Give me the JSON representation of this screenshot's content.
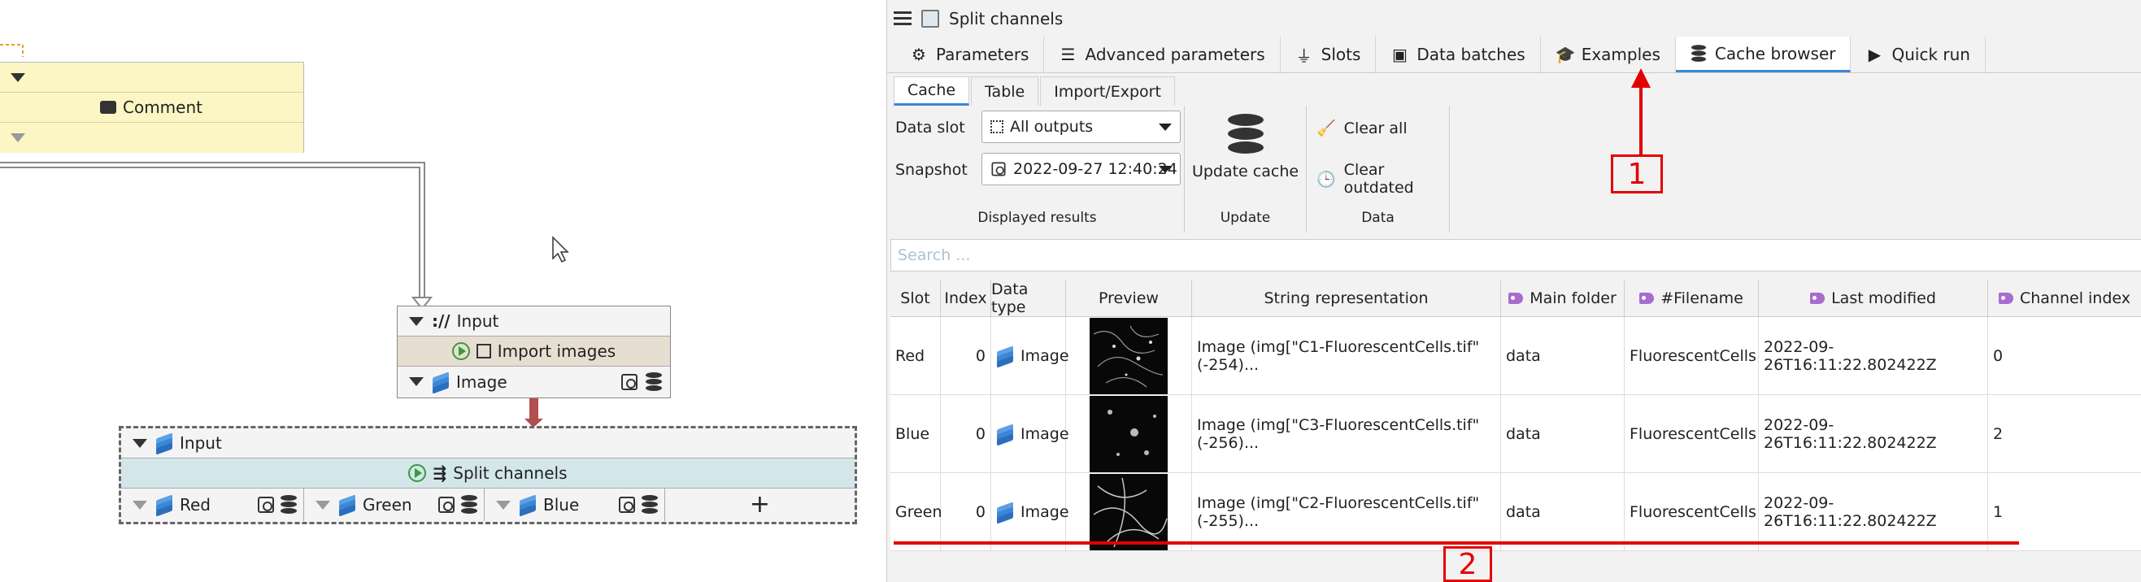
{
  "canvas": {
    "comment_node": {
      "label": "Comment"
    },
    "import_node": {
      "input_label": "Input",
      "input_prefix": "://",
      "action": "Import images",
      "output": "Image"
    },
    "split_node": {
      "input_label": "Input",
      "action": "Split channels",
      "outputs": [
        "Red",
        "Green",
        "Blue"
      ],
      "add_symbol": "+"
    }
  },
  "panel": {
    "title": "Split channels",
    "tabs": [
      {
        "label": "Parameters",
        "icon": "gear-icon"
      },
      {
        "label": "Advanced parameters",
        "icon": "sliders-icon"
      },
      {
        "label": "Slots",
        "icon": "plug-icon"
      },
      {
        "label": "Data batches",
        "icon": "batch-icon"
      },
      {
        "label": "Examples",
        "icon": "graduation-cap-icon"
      },
      {
        "label": "Cache browser",
        "icon": "database-icon"
      },
      {
        "label": "Quick run",
        "icon": "play-icon"
      }
    ],
    "subtabs": [
      "Cache",
      "Table",
      "Import/Export"
    ],
    "ribbon": {
      "data_slot_label": "Data slot",
      "data_slot_value": "All outputs",
      "snapshot_label": "Snapshot",
      "snapshot_value": "2022-09-27 12:40:24",
      "displayed_results": "Displayed results",
      "update_cache": "Update cache",
      "update_group": "Update",
      "clear_all": "Clear all",
      "clear_outdated": "Clear outdated",
      "data_group": "Data"
    },
    "search_placeholder": "Search ...",
    "table": {
      "columns": [
        "Slot",
        "Index",
        "Data type",
        "Preview",
        "String representation",
        "Main folder",
        "#Filename",
        "Last modified",
        "Channel index"
      ],
      "rows": [
        {
          "slot": "Red",
          "index": "0",
          "type": "Image",
          "repr": "Image (img[\"C1-FluorescentCells.tif\" (-254)...",
          "folder": "data",
          "filename": "FluorescentCells",
          "modified": "2022-09-26T16:11:22.802422Z",
          "channel": "0"
        },
        {
          "slot": "Blue",
          "index": "0",
          "type": "Image",
          "repr": "Image (img[\"C3-FluorescentCells.tif\" (-256)...",
          "folder": "data",
          "filename": "FluorescentCells",
          "modified": "2022-09-26T16:11:22.802422Z",
          "channel": "2"
        },
        {
          "slot": "Green",
          "index": "0",
          "type": "Image",
          "repr": "Image (img[\"C2-FluorescentCells.tif\" (-255)...",
          "folder": "data",
          "filename": "FluorescentCells",
          "modified": "2022-09-26T16:11:22.802422Z",
          "channel": "1"
        }
      ]
    }
  },
  "annotations": {
    "one": "1",
    "two": "2"
  },
  "colors": {
    "accent": "#3b87d6",
    "annotation": "#e30000",
    "comment_bg": "#fbf6c4",
    "split_bg": "#d3e6ea",
    "import_bg": "#e6ded1"
  }
}
